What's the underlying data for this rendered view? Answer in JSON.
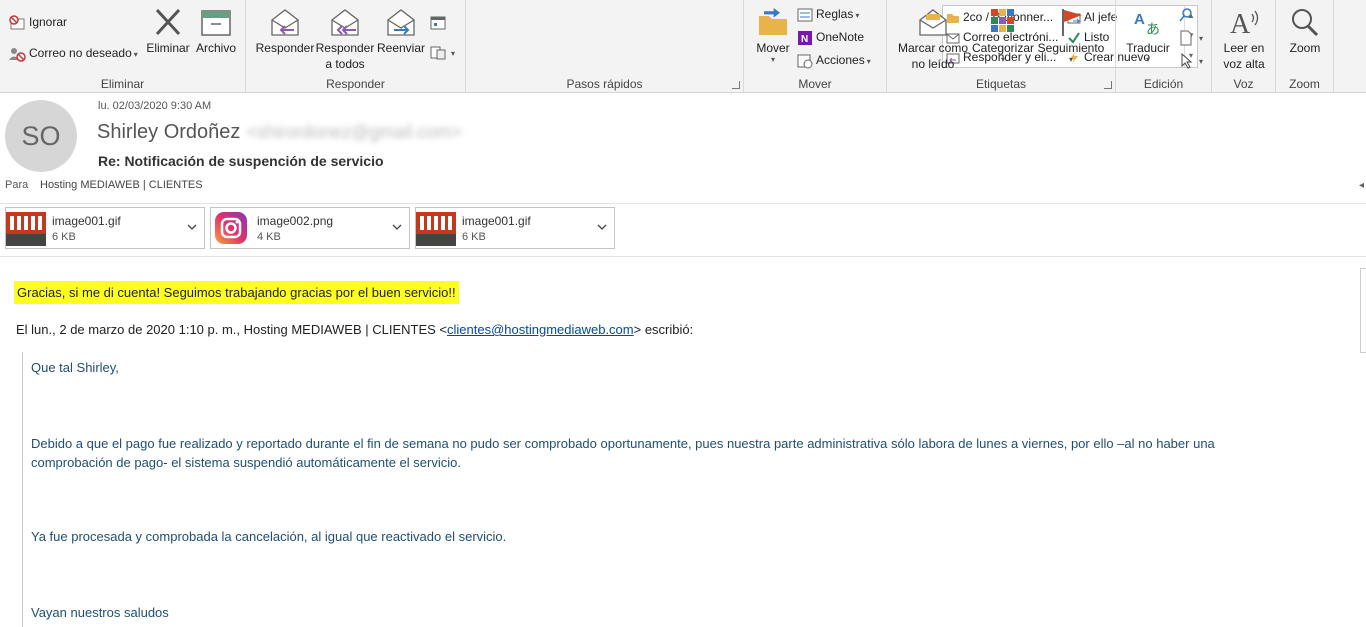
{
  "ribbon": {
    "eliminar_group": {
      "label": "Eliminar",
      "ignorar": "Ignorar",
      "correo_no_deseado": "Correo no deseado",
      "eliminar": "Eliminar",
      "archivo": "Archivo"
    },
    "responder_group": {
      "label": "Responder",
      "responder": "Responder",
      "responder_todos_1": "Responder",
      "responder_todos_2": "a todos",
      "reenviar": "Reenviar"
    },
    "pasos_rapidos": {
      "label": "Pasos rápidos",
      "items": [
        "2co / Payonner...",
        "Al jefe",
        "Correo electróni...",
        "Listo",
        "Responder y eli...",
        "Crear nuevo"
      ]
    },
    "mover_group": {
      "label": "Mover",
      "mover": "Mover",
      "reglas": "Reglas",
      "onenote": "OneNote",
      "acciones": "Acciones"
    },
    "etiquetas_group": {
      "label": "Etiquetas",
      "marcar_1": "Marcar como",
      "marcar_2": "no leído",
      "categorizar": "Categorizar",
      "seguimiento": "Seguimiento"
    },
    "edicion_group": {
      "label": "Edición",
      "traducir": "Traducir"
    },
    "voz_group": {
      "label": "Voz",
      "leer_1": "Leer en",
      "leer_2": "voz alta"
    },
    "zoom_group": {
      "label": "Zoom",
      "zoom": "Zoom"
    }
  },
  "message": {
    "avatar_initials": "SO",
    "date": "lu. 02/03/2020 9:30 AM",
    "sender_name": "Shirley Ordoñez",
    "sender_email": "<shirordonez@gmail.com>",
    "subject": "Re: Notificación de suspención de servicio",
    "to_label": "Para",
    "to_value": "Hosting MEDIAWEB | CLIENTES"
  },
  "attachments": [
    {
      "name": "image001.gif",
      "size": "6 KB"
    },
    {
      "name": "image002.png",
      "size": "4 KB"
    },
    {
      "name": "image001.gif",
      "size": "6 KB"
    }
  ],
  "body": {
    "highlight": "Gracias, si me di cuenta! Seguimos trabajando gracias por el buen servicio!!",
    "quote_head_prefix": "El lun., 2 de marzo de 2020 1:10 p. m., Hosting MEDIAWEB | CLIENTES <",
    "quote_head_email": "clientes@hostingmediaweb.com",
    "quote_head_suffix": "> escribió:",
    "paragraphs": [
      "Que tal Shirley,",
      "Debido a que el pago fue realizado y reportado durante el fin de semana no pudo ser comprobado oportunamente, pues nuestra parte administrativa sólo labora de lunes a viernes, por ello –al no haber una comprobación de pago- el sistema suspendió automáticamente el servicio.",
      "Ya fue procesada y comprobada la cancelación, al igual que reactivado el servicio.",
      "Vayan nuestros saludos"
    ]
  },
  "colors": {
    "highlight": "#ffff1f",
    "quote_text": "#1f4e79",
    "link": "#0645ad"
  }
}
